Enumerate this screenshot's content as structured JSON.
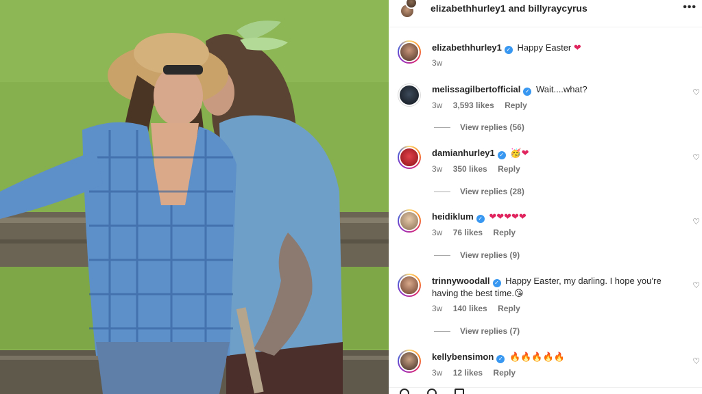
{
  "header": {
    "user1": "elizabethhurley1",
    "and": "and",
    "user2": "billyraycyrus",
    "more_icon": "more-horizontal-icon"
  },
  "caption": {
    "username": "elizabethhurley1",
    "text": "Happy Easter",
    "emoji": "❤",
    "time": "3w"
  },
  "comments": [
    {
      "username": "melissagilbertofficial",
      "text": "Wait....what?",
      "time": "3w",
      "likes": "3,593 likes",
      "reply": "Reply",
      "view_replies": "View replies (56)"
    },
    {
      "username": "damianhurley1",
      "text": "🥳❤",
      "time": "3w",
      "likes": "350 likes",
      "reply": "Reply",
      "view_replies": "View replies (28)"
    },
    {
      "username": "heidiklum",
      "text": "❤❤❤❤❤",
      "time": "3w",
      "likes": "76 likes",
      "reply": "Reply",
      "view_replies": "View replies (9)"
    },
    {
      "username": "trinnywoodall",
      "text": "Happy Easter, my darling. I hope you’re having the best time.😘",
      "time": "3w",
      "likes": "140 likes",
      "reply": "Reply",
      "view_replies": "View replies (7)"
    },
    {
      "username": "kellybensimon",
      "text": "🔥🔥🔥🔥🔥",
      "time": "3w",
      "likes": "12 likes",
      "reply": "Reply"
    }
  ],
  "icons": {
    "verified": "verified-badge-icon",
    "heart": "heart-outline-icon"
  },
  "colors": {
    "verified_blue": "#3897f0",
    "heart_red": "#e0245e",
    "story_ring": "#d62976"
  }
}
